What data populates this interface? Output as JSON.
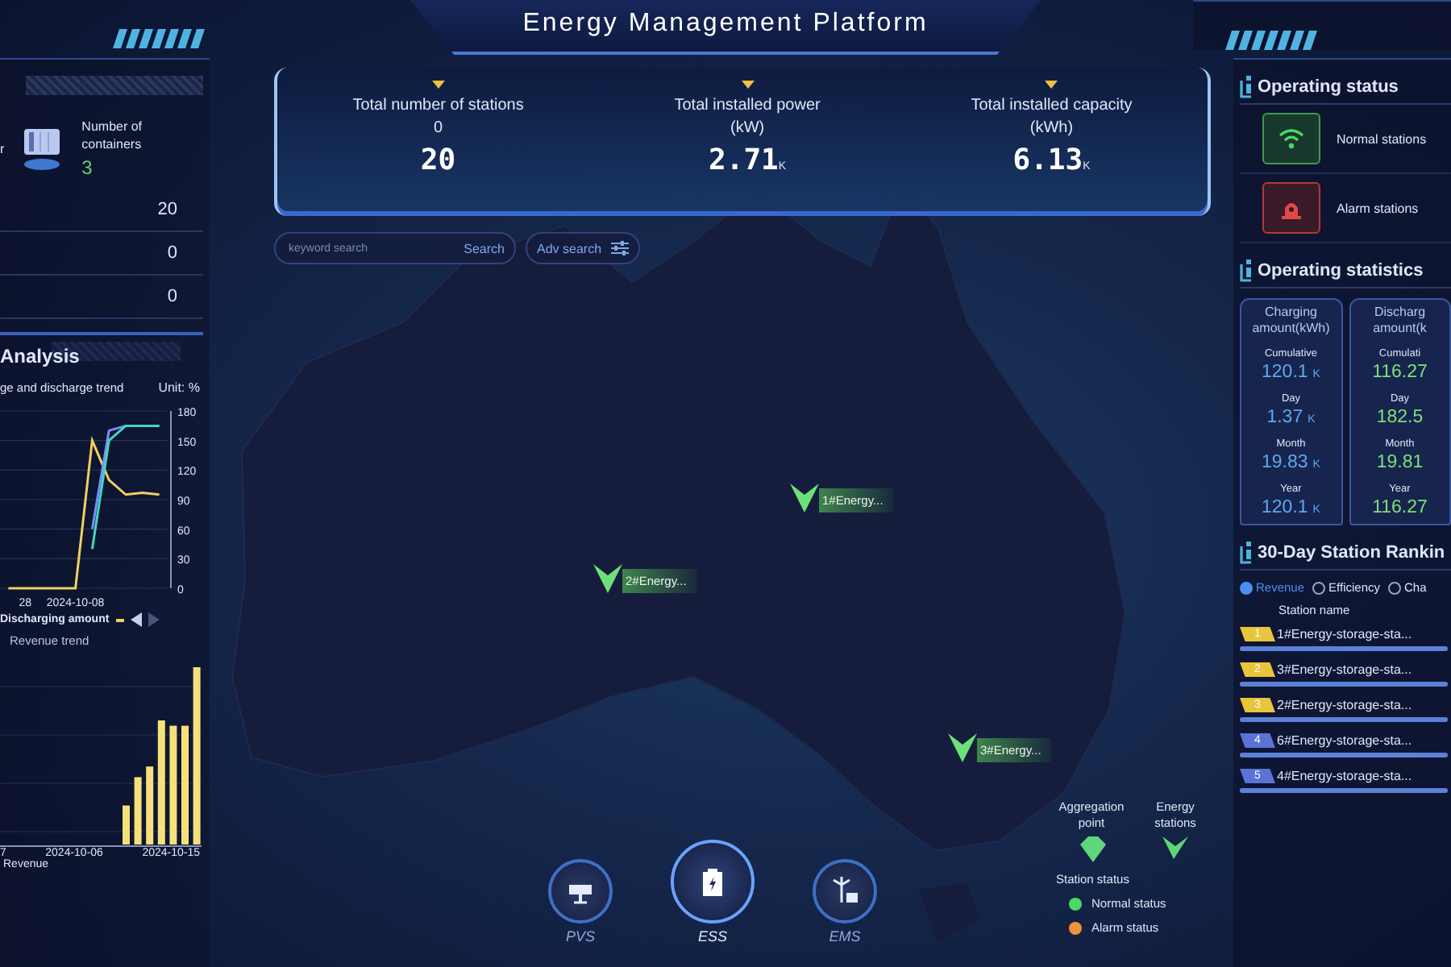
{
  "header": {
    "title": "Energy Management Platform"
  },
  "summary": [
    {
      "label": "Total number of stations",
      "unit": "0",
      "value": "20"
    },
    {
      "label": "Total installed power",
      "unit": "(kW)",
      "value": "2.71",
      "suffix": "K"
    },
    {
      "label": "Total installed capacity",
      "unit": "(kWh)",
      "value": "6.13",
      "suffix": "K"
    }
  ],
  "search": {
    "placeholder": "keyword search",
    "button": "Search",
    "advanced": "Adv search"
  },
  "map": {
    "markers": [
      {
        "label": "1#Energy..."
      },
      {
        "label": "2#Energy..."
      },
      {
        "label": "3#Energy..."
      }
    ],
    "legend": {
      "symbols": [
        {
          "label": "Aggregation point",
          "kind": "aggregation"
        },
        {
          "label": "Energy stations",
          "kind": "station"
        }
      ],
      "status_title": "Station status",
      "statuses": [
        {
          "label": "Normal status",
          "color": "#4cd964"
        },
        {
          "label": "Alarm status",
          "color": "#f0923a"
        }
      ]
    }
  },
  "nav": [
    {
      "label": "PVS",
      "selected": false
    },
    {
      "label": "ESS",
      "selected": true
    },
    {
      "label": "EMS",
      "selected": false
    }
  ],
  "left_panel": {
    "cut_label": "r",
    "containers": {
      "label": "Number of containers",
      "value": "3"
    },
    "rows": [
      {
        "value": "20"
      },
      {
        "value": "0"
      },
      {
        "value": "0"
      }
    ],
    "analysis": {
      "title": "Analysis",
      "subtitle": "ge and discharge trend",
      "unit": "Unit: %",
      "chart_data": {
        "type": "line",
        "categories": [
          null,
          "28",
          null,
          null,
          "2024-10-08",
          null,
          null,
          null,
          null,
          null
        ],
        "ylim": [
          0,
          180
        ],
        "grid": true,
        "yticks": [
          0,
          30,
          60,
          90,
          120,
          150,
          180
        ],
        "series": [
          {
            "name": "Discharging amount",
            "color": "#f0d060",
            "values": [
              0,
              0,
              0,
              0,
              0,
              150,
              110,
              95,
              97,
              95
            ]
          },
          {
            "color": "#7b8cff",
            "values": [
              null,
              null,
              null,
              null,
              null,
              60,
              160,
              165,
              165,
              165
            ]
          },
          {
            "color": "#3fd6c0",
            "values": [
              null,
              null,
              null,
              null,
              null,
              40,
              150,
              165,
              165,
              165
            ]
          }
        ]
      }
    },
    "revenue": {
      "title": "Revenue trend",
      "xlabels": [
        "7",
        "2024-10-06",
        "2024-10-15"
      ],
      "legend": "Revenue"
    }
  },
  "operating_status": {
    "title": "Operating status",
    "items": [
      {
        "label": "Normal stations",
        "kind": "normal"
      },
      {
        "label": "Alarm stations",
        "kind": "alarm"
      }
    ]
  },
  "operating_statistics": {
    "title": "Operating statistics",
    "cards": [
      {
        "title": "Charging amount(kWh)",
        "kind": "charging",
        "rows": [
          {
            "label": "Cumulative",
            "value": "120.1",
            "unit": "K"
          },
          {
            "label": "Day",
            "value": "1.37",
            "unit": "K"
          },
          {
            "label": "Month",
            "value": "19.83",
            "unit": "K"
          },
          {
            "label": "Year",
            "value": "120.1",
            "unit": "K"
          }
        ]
      },
      {
        "title": "Discharg amount(k",
        "kind": "discharging",
        "rows": [
          {
            "label": "Cumulati",
            "value": "116.27"
          },
          {
            "label": "Day",
            "value": "182.5"
          },
          {
            "label": "Month",
            "value": "19.81"
          },
          {
            "label": "Year",
            "value": "116.27"
          }
        ]
      }
    ]
  },
  "ranking": {
    "title": "30-Day Station Rankin",
    "options": [
      {
        "label": "Revenue",
        "selected": true
      },
      {
        "label": "Efficiency",
        "selected": false
      },
      {
        "label": "Cha",
        "selected": false
      }
    ],
    "column": "Station name",
    "rows": [
      {
        "rank": "1",
        "name": "1#Energy-storage-sta...",
        "color": "#e8c53a",
        "level": 1
      },
      {
        "rank": "2",
        "name": "3#Energy-storage-sta...",
        "color": "#e8c53a",
        "level": 1
      },
      {
        "rank": "3",
        "name": "2#Energy-storage-sta...",
        "color": "#e8c53a",
        "level": 1
      },
      {
        "rank": "4",
        "name": "6#Energy-storage-sta...",
        "color": "#5b72d6",
        "level": 1
      },
      {
        "rank": "5",
        "name": "4#Energy-storage-sta...",
        "color": "#5b72d6",
        "level": 1
      }
    ]
  }
}
